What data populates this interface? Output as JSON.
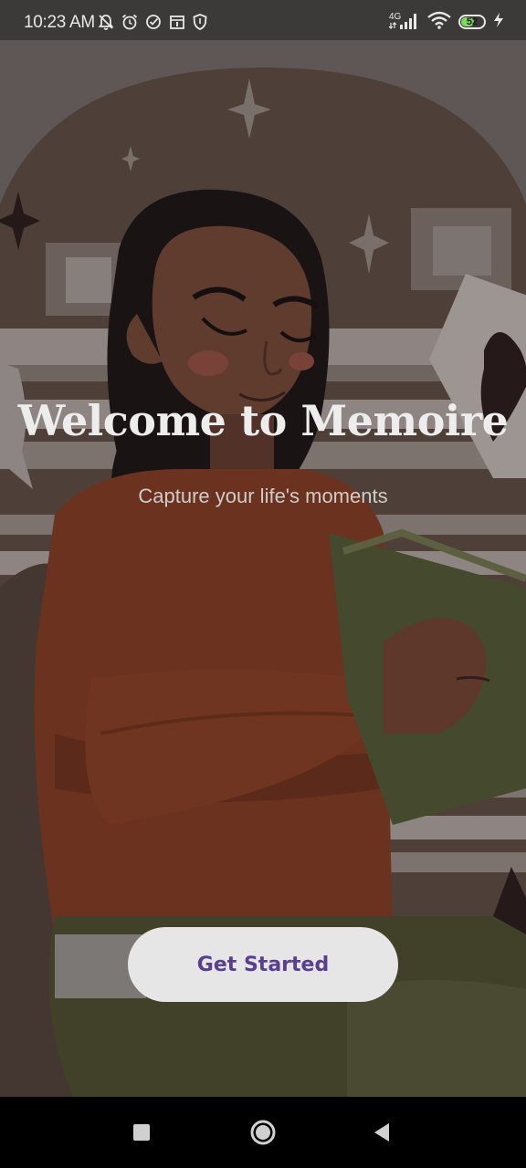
{
  "status_bar": {
    "time": "10:23 AM",
    "network": "4G",
    "battery_level": "52",
    "icons": [
      "mute-bell-icon",
      "alarm-icon",
      "check-circle-icon",
      "calendar-icon",
      "shield-icon",
      "signal-icon",
      "wifi-icon",
      "battery-icon",
      "charging-icon"
    ]
  },
  "welcome": {
    "title": "Welcome to Memoire",
    "subtitle": "Capture your life's moments",
    "button_label": "Get Started",
    "button_text_color": "#5b3f8f"
  },
  "nav_bar": {
    "icons": [
      "recents-square-icon",
      "home-circle-icon",
      "back-triangle-icon"
    ]
  }
}
